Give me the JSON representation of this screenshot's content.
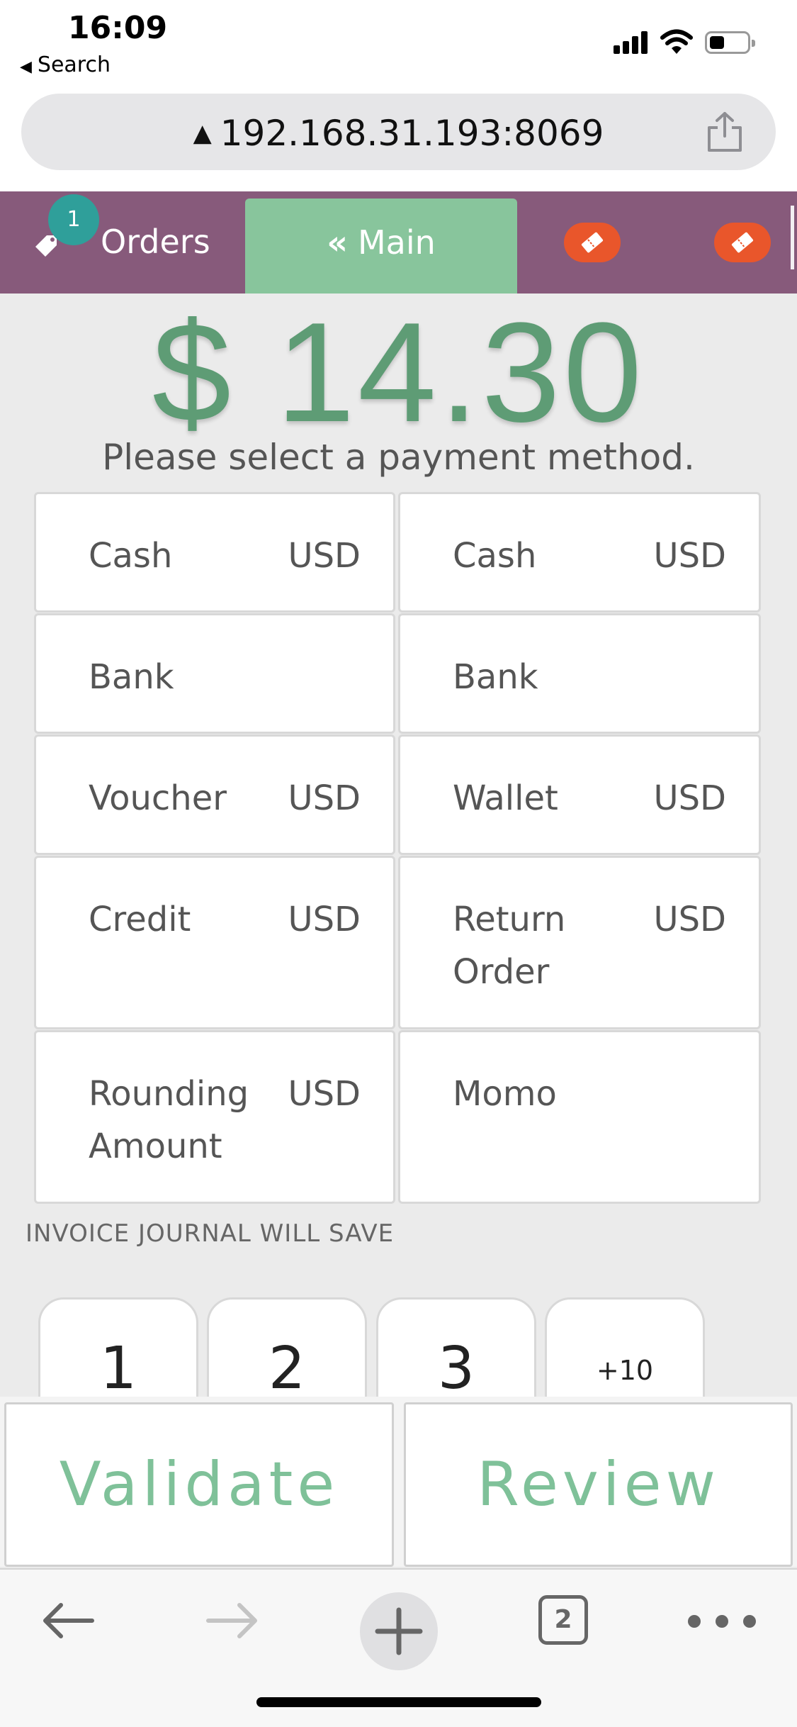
{
  "status_bar": {
    "time": "16:09",
    "back_label": "Search"
  },
  "url_bar": {
    "url": "192.168.31.193:8069"
  },
  "pos_header": {
    "orders_label": "Orders",
    "orders_badge": "1",
    "main_tab_label": "Main",
    "accent_color": "#875a7b",
    "main_tab_color": "#88c59c",
    "ticket_color": "#e9562b"
  },
  "payment": {
    "amount": "$ 14.30",
    "amount_color": "#5e9c75",
    "prompt": "Please select a payment method.",
    "methods": [
      {
        "name": "Cash",
        "currency": "USD"
      },
      {
        "name": "Cash",
        "currency": "USD"
      },
      {
        "name": "Bank",
        "currency": ""
      },
      {
        "name": "Bank",
        "currency": ""
      },
      {
        "name": "Voucher",
        "currency": "USD"
      },
      {
        "name": "Wallet",
        "currency": "USD"
      },
      {
        "name": "Credit",
        "currency": "USD"
      },
      {
        "name": "Return Order",
        "currency": "USD"
      },
      {
        "name": "Rounding Amount",
        "currency": "USD"
      },
      {
        "name": "Momo",
        "currency": ""
      }
    ],
    "journal_note": "INVOICE JOURNAL WILL SAVE",
    "numpad_keys": [
      "1",
      "2",
      "3",
      "+10"
    ],
    "validate_label": "Validate",
    "review_label": "Review",
    "button_text_color": "#7fc199"
  },
  "browser_toolbar": {
    "tab_count": "2"
  }
}
